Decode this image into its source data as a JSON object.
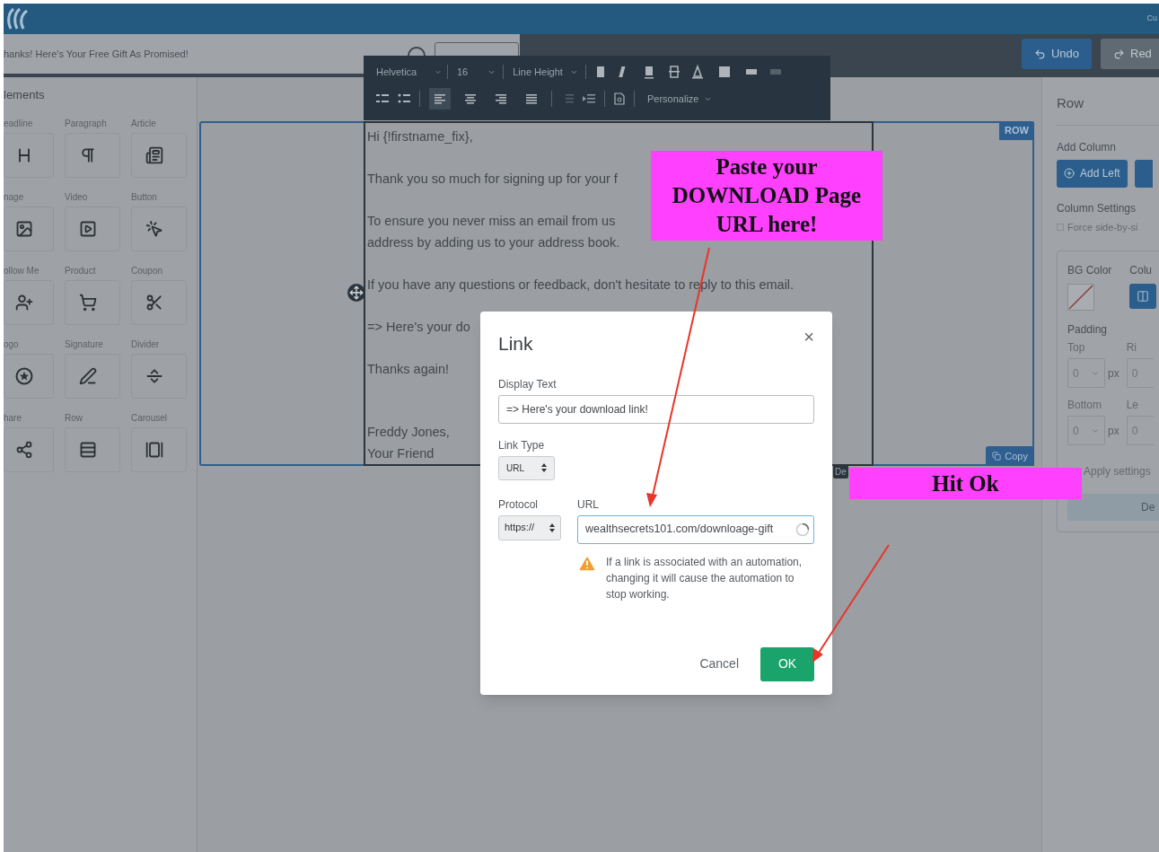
{
  "header": {
    "corner_text": "Cu"
  },
  "subheader": {
    "subject": "hanks! Here's Your Free Gift As Promised!",
    "undo": "Undo",
    "redo": "Red"
  },
  "elements_panel": {
    "title": "lements",
    "items": [
      {
        "label": "eadline"
      },
      {
        "label": "Paragraph"
      },
      {
        "label": "Article"
      },
      {
        "label": "nage"
      },
      {
        "label": "Video"
      },
      {
        "label": "Button"
      },
      {
        "label": "ollow Me"
      },
      {
        "label": "Product"
      },
      {
        "label": "Coupon"
      },
      {
        "label": "ogo"
      },
      {
        "label": "Signature"
      },
      {
        "label": "Divider"
      },
      {
        "label": "hare"
      },
      {
        "label": "Row"
      },
      {
        "label": "Carousel"
      }
    ]
  },
  "toolbar": {
    "font": "Helvetica",
    "size": "16",
    "line_height": "Line Height",
    "personalize": "Personalize",
    "align": [
      {
        "kind": "left",
        "selected": true
      },
      {
        "kind": "center",
        "selected": false
      },
      {
        "kind": "right",
        "selected": false
      },
      {
        "kind": "justify",
        "selected": false
      }
    ]
  },
  "canvas": {
    "row_tag": "ROW",
    "copy": "Copy",
    "delete": "De",
    "paragraphs": [
      {
        "kind": "text",
        "lines": [
          "Hi {!firstname_fix},"
        ]
      },
      {
        "kind": "text",
        "lines": [
          "Thank you so much for signing up for your f"
        ]
      },
      {
        "kind": "text",
        "lines": [
          "To ensure you never miss an email from us",
          "address by adding us to your address book."
        ]
      },
      {
        "kind": "text",
        "lines": [
          "If you have any questions or feedback, don't hesitate to reply to this email."
        ]
      },
      {
        "kind": "text",
        "lines": [
          "=> Here's your do"
        ]
      },
      {
        "kind": "text",
        "lines": [
          "Thanks again!"
        ]
      },
      {
        "kind": "signature",
        "lines": [
          "Freddy Jones,",
          "Your Friend"
        ]
      }
    ]
  },
  "right_panel": {
    "title": "Row",
    "add_column": "Add Column",
    "add_left": "Add Left",
    "column_settings": "Column Settings",
    "force": {
      "label": "Force side-by-si",
      "checked": false
    },
    "bg_color": "BG Color",
    "column_label": "Colu",
    "padding": "Padding",
    "top": "Top",
    "right": "Ri",
    "bottom": "Bottom",
    "left": "Le",
    "top_value": "0",
    "right_value": "0",
    "bottom_value": "0",
    "left_value": "0",
    "top_unit": "px",
    "bottom_unit": "px",
    "apply": "Apply settings",
    "delete": "De"
  },
  "dialog": {
    "title": "Link",
    "close": "×",
    "display_text_label": "Display Text",
    "display_text": "=> Here's your download link!",
    "link_type_label": "Link Type",
    "link_type": "URL",
    "protocol_label": "Protocol",
    "protocol": "https://",
    "url_label": "URL",
    "url": "wealthsecrets101.com/downloage-gift",
    "warning": "If a link is associated with an automation, changing it will cause the automation to stop working.",
    "cancel": "Cancel",
    "ok": "OK"
  },
  "annotations": [
    {
      "text": "Paste your\nDOWNLOAD Page\nURL here!"
    },
    {
      "text": "Hit Ok"
    }
  ]
}
